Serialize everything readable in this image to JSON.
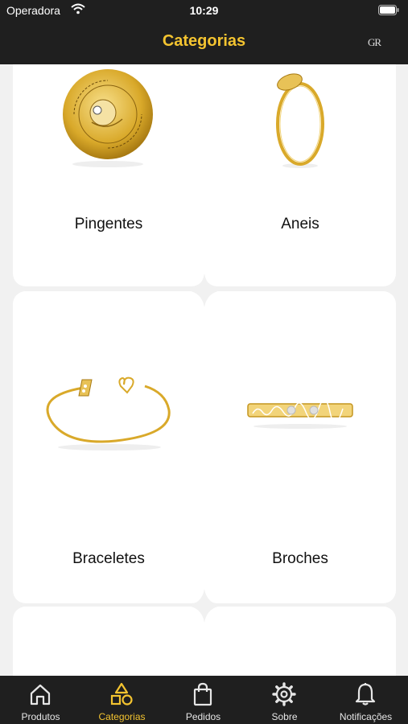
{
  "status_bar": {
    "carrier": "Operadora",
    "time": "10:29"
  },
  "header": {
    "title": "Categorias",
    "logo_text": "GR"
  },
  "categories": [
    {
      "label": "Pingentes"
    },
    {
      "label": "Aneis"
    },
    {
      "label": "Braceletes"
    },
    {
      "label": "Broches"
    }
  ],
  "tabs": [
    {
      "label": "Produtos",
      "icon": "home-icon",
      "active": false
    },
    {
      "label": "Categorias",
      "icon": "shapes-icon",
      "active": true
    },
    {
      "label": "Pedidos",
      "icon": "shopping-bag-icon",
      "active": false
    },
    {
      "label": "Sobre",
      "icon": "gear-icon",
      "active": false
    },
    {
      "label": "Notificações",
      "icon": "bell-icon",
      "active": false
    }
  ],
  "colors": {
    "accent": "#f4c430",
    "bar_background": "#1f1f1f",
    "page_background": "#f1f1f1",
    "gold": "#d9a92a"
  }
}
